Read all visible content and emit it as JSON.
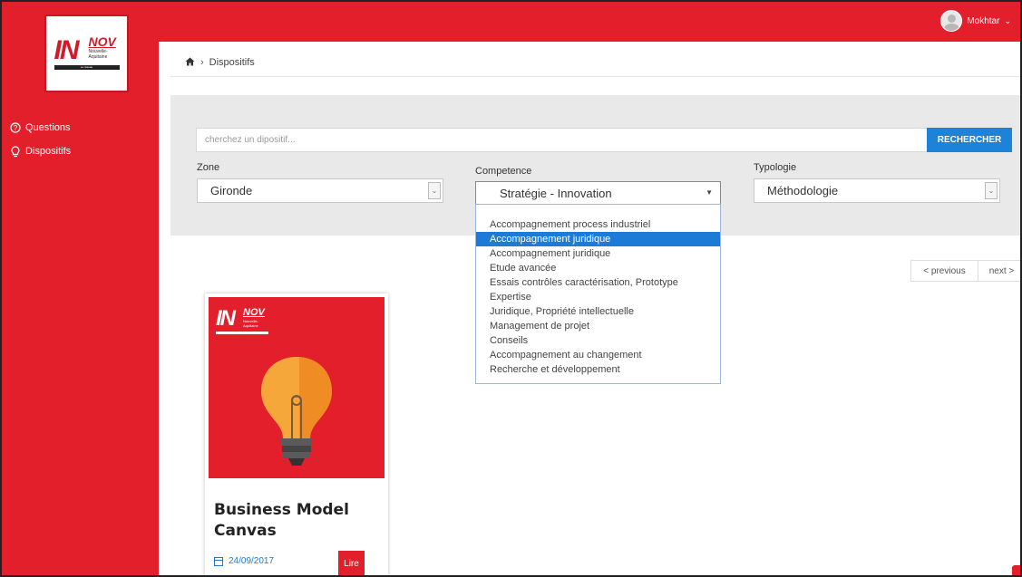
{
  "brand": {
    "logo_main": "IN",
    "logo_sup": "NOV",
    "logo_sub": "Nouvelle-Aquitaine",
    "logo_bar": "Le réseau",
    "accent_color": "#e41f2c",
    "link_color": "#1e7ad7"
  },
  "sidebar": {
    "items": [
      {
        "label": "Questions",
        "icon": "question-circle-icon"
      },
      {
        "label": "Dispositifs",
        "icon": "lightbulb-icon"
      }
    ]
  },
  "user": {
    "name": "Mokhtar"
  },
  "breadcrumb": {
    "current": "Dispositifs"
  },
  "search": {
    "placeholder": "cherchez un dipositif...",
    "button_label": "RECHERCHER"
  },
  "filters": {
    "zone": {
      "label": "Zone",
      "value": "Gironde"
    },
    "competence": {
      "label": "Competence",
      "value": "Stratégie - Innovation"
    },
    "typologie": {
      "label": "Typologie",
      "value": "Méthodologie"
    }
  },
  "competence_options": [
    "Accompagnement process industriel",
    "Accompagnement juridique",
    "Accompagnement juridique",
    "Etude avancée",
    "Essais contrôles caractérisation, Prototype",
    "Expertise",
    "Juridique, Propriété intellectuelle",
    "Management de projet",
    "Conseils",
    "Accompagnement au changement",
    "Recherche et développement"
  ],
  "competence_highlighted_index": 1,
  "pagination": {
    "previous": "< previous",
    "next": "next >"
  },
  "card": {
    "title": "Business Model Canvas",
    "date": "24/09/2017",
    "action": "Lire",
    "logo_main": "IN",
    "logo_sup": "NOV",
    "logo_sub": "Nouvelle-Aquitaine"
  }
}
